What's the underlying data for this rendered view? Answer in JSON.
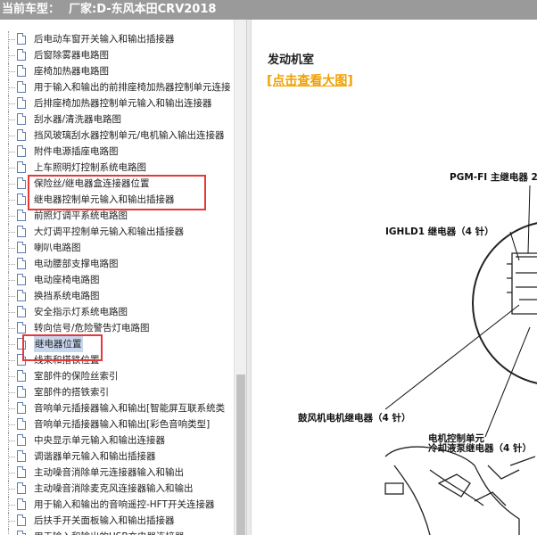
{
  "header": {
    "current_model_label": "当前车型：",
    "model_value": "厂家:D-东风本田CRV2018"
  },
  "tree": {
    "items": [
      "后电动车窗开关输入和输出插接器",
      "后窗除雾器电路图",
      "座椅加热器电路图",
      "用于输入和输出的前排座椅加热器控制单元连接",
      "后排座椅加热器控制单元输入和输出连接器",
      "刮水器/清洗器电路图",
      "挡风玻璃刮水器控制单元/电机输入输出连接器",
      "附件电源插座电路图",
      "上车照明灯控制系统电路图",
      "保险丝/继电器盒连接器位置",
      "继电器控制单元输入和输出插接器",
      "前照灯调平系统电路图",
      "大灯调平控制单元输入和输出插接器",
      "喇叭电路图",
      "电动腰部支撑电路图",
      "电动座椅电路图",
      "换挡系统电路图",
      "安全指示灯系统电路图",
      "转向信号/危险警告灯电路图",
      "继电器位置",
      "线束和搭铁位置",
      "室部件的保险丝索引",
      "室部件的搭铁索引",
      "音响单元插接器输入和输出[智能屏互联系统类",
      "音响单元插接器输入和输出[彩色音响类型]",
      "中央显示单元输入和输出连接器",
      "调谐器单元输入和输出插接器",
      "主动噪音消除单元连接器输入和输出",
      "主动噪音消除麦克风连接器输入和输出",
      "用于输入和输出的音响遥控-HFT开关连接器",
      "后扶手开关面板输入和输出插接器",
      "用于输入和输出的USB充电器连接器"
    ],
    "selected_index": 19
  },
  "content": {
    "section_title": "发动机室",
    "view_large_link": "[点击查看大图]",
    "diagram_labels": {
      "pgm_fi": "PGM-FI 主继电器 2",
      "ighld1": "IGHLD1 继电器（4 针）",
      "blower": "鼓风机电机继电器（4 针）",
      "cooling_line1": "电机控制单元",
      "cooling_line2": "冷却液泵继电器（4 针）"
    }
  }
}
